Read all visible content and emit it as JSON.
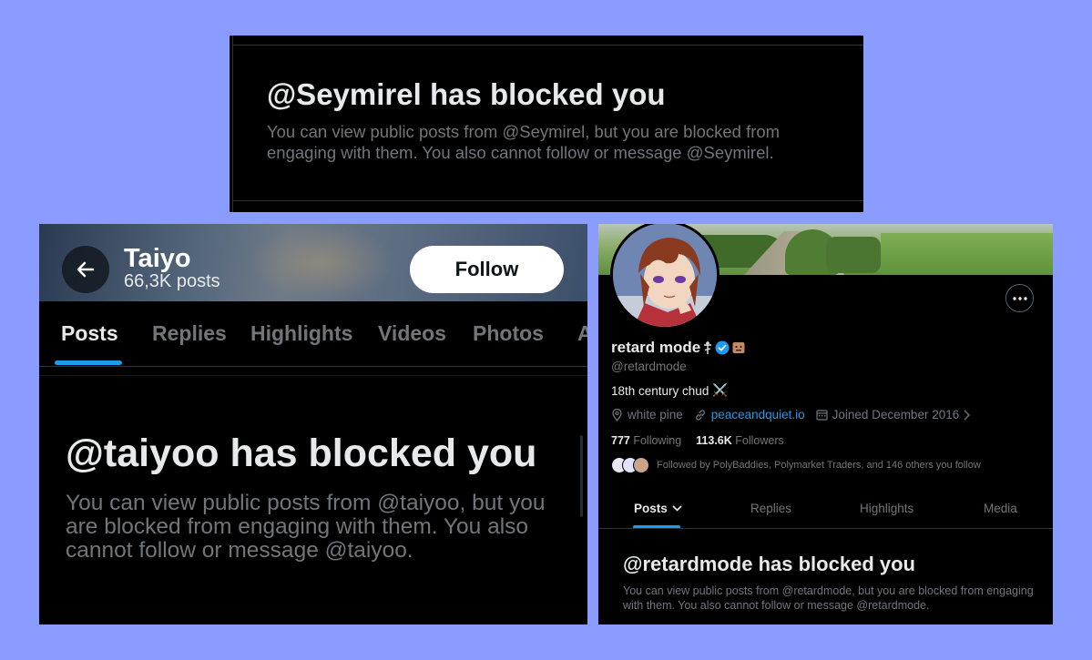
{
  "colors": {
    "background": "#8a9cff",
    "panel": "#000000",
    "primary_text": "#e7e9ea",
    "secondary_text": "#71767b",
    "accent": "#1d9bf0",
    "verified": "#1d9bf0"
  },
  "top_panel": {
    "title": "@Seymirel has blocked you",
    "body": "You can view public posts from @Seymirel, but you are blocked from engaging with them. You also cannot follow or message @Seymirel."
  },
  "left_panel": {
    "header": {
      "back_icon": "arrow-left-icon",
      "name": "Taiyo",
      "posts_count": "66,3K posts",
      "follow_label": "Follow"
    },
    "tabs": [
      {
        "label": "Posts",
        "active": true
      },
      {
        "label": "Replies"
      },
      {
        "label": "Highlights"
      },
      {
        "label": "Videos"
      },
      {
        "label": "Photos"
      },
      {
        "label": "A"
      }
    ],
    "blocked_title": "@taiyoo has blocked you",
    "blocked_body": "You can view public posts from @taiyoo, but you are blocked from engaging with them. You also cannot follow or message @taiyoo."
  },
  "right_panel": {
    "more_icon": "ellipsis-icon",
    "display_name": "retard mode",
    "name_symbols": [
      "orthodox-cross-icon",
      "verified-badge-icon",
      "emoji-icon"
    ],
    "handle": "@retardmode",
    "bio": "18th century chud",
    "bio_emoji": "⚔️",
    "location": "white pine",
    "website": "peaceandquiet.io",
    "joined": "Joined December 2016",
    "following_count": "777",
    "following_label": "Following",
    "followers_count": "113.6K",
    "followers_label": "Followers",
    "followed_by": "Followed by PolyBaddies, Polymarket Traders, and 146 others you follow",
    "tabs": [
      {
        "label": "Posts",
        "active": true
      },
      {
        "label": "Replies"
      },
      {
        "label": "Highlights"
      },
      {
        "label": "Media"
      }
    ],
    "blocked_title": "@retardmode has blocked you",
    "blocked_body": "You can view public posts from @retardmode, but you are blocked from engaging with them. You also cannot follow or message @retardmode."
  }
}
